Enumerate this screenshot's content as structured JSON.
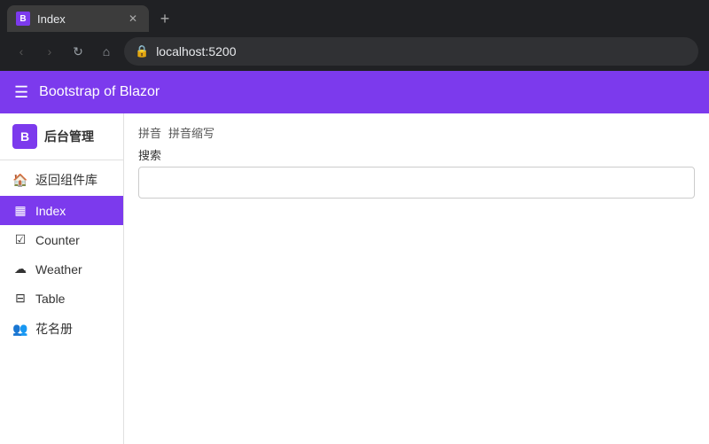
{
  "browser": {
    "tab_title": "Index",
    "url": "localhost:5200",
    "new_tab_icon": "+"
  },
  "app": {
    "header": {
      "menu_icon": "☰",
      "title": "Bootstrap of Blazor"
    },
    "sidebar": {
      "brand_icon": "B",
      "brand_name": "后台管理",
      "nav_items": [
        {
          "id": "back",
          "icon": "🏠",
          "label": "返回组件库",
          "active": false
        },
        {
          "id": "index",
          "icon": "⊞",
          "label": "Index",
          "active": true
        },
        {
          "id": "counter",
          "icon": "☑",
          "label": "Counter",
          "active": false
        },
        {
          "id": "weather",
          "icon": "☁",
          "label": "Weather",
          "active": false
        },
        {
          "id": "table",
          "icon": "⊟",
          "label": "Table",
          "active": false
        },
        {
          "id": "roster",
          "icon": "👥",
          "label": "花名册",
          "active": false
        }
      ]
    },
    "main": {
      "pinyin_items": [
        "拼音",
        "拼音缩写"
      ],
      "search_label": "搜索",
      "search_placeholder": ""
    }
  }
}
